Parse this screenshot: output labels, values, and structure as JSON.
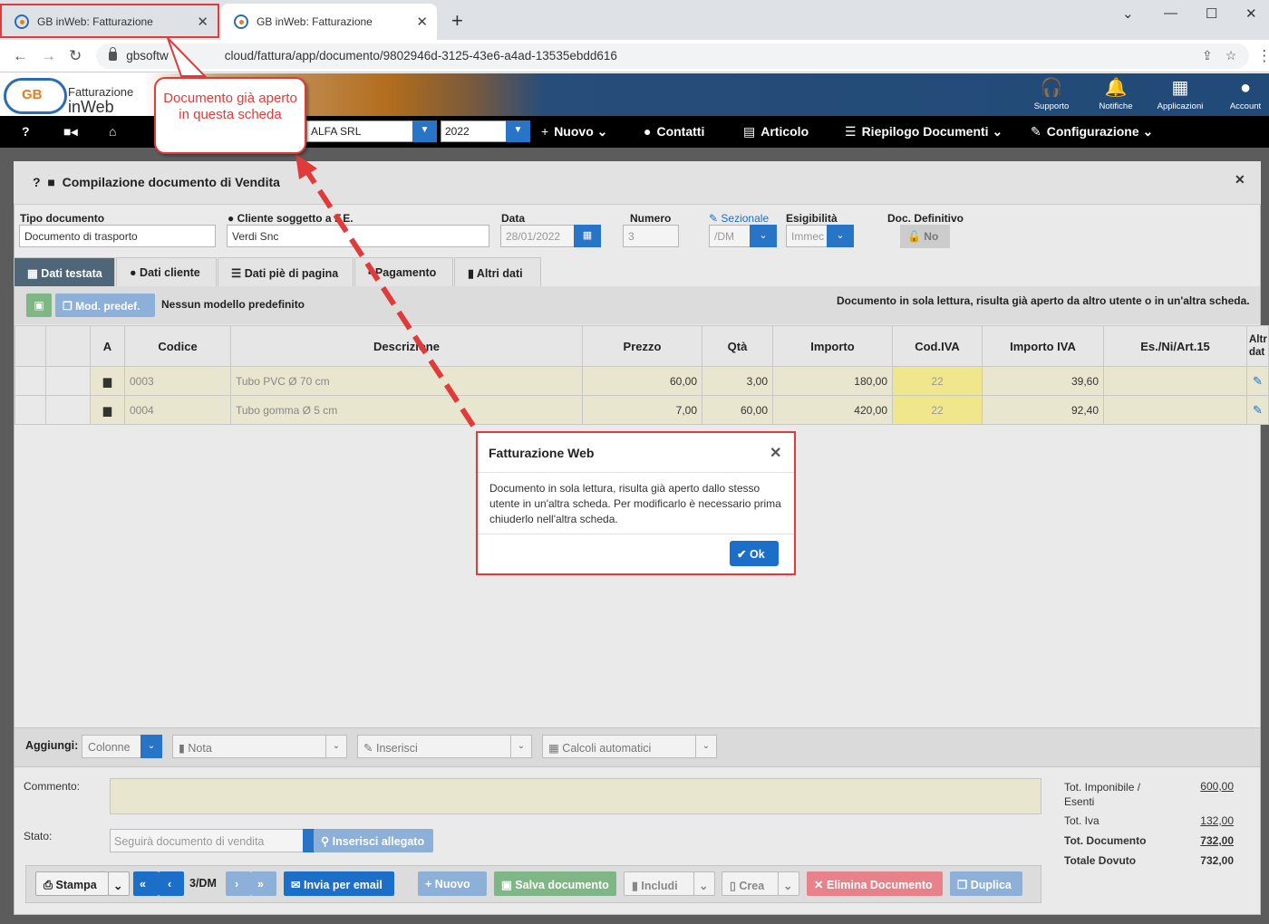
{
  "browser": {
    "tabs": [
      {
        "title": "GB inWeb: Fatturazione"
      },
      {
        "title": "GB inWeb: Fatturazione"
      }
    ],
    "url": "gbsoftware.cloud/fattura/app/documento/9802946d-3125-43e6-a4ad-13535ebdd616",
    "url_visible_prefix": "gbsoftw",
    "url_visible_suffix": "cloud/fattura/app/documento/9802946d-3125-43e6-a4ad-13535ebdd616"
  },
  "logo": {
    "line1": "Fatturazione",
    "line2": "inWeb",
    "mark": "GB"
  },
  "header_buttons": [
    {
      "label": "Supporto",
      "icon": "headset-icon"
    },
    {
      "label": "Notifiche",
      "icon": "bell-icon"
    },
    {
      "label": "Applicazioni",
      "icon": "grid-icon"
    },
    {
      "label": "Account",
      "icon": "user-icon"
    }
  ],
  "menubar": {
    "help": "?",
    "company": "ALFA SRL",
    "year": "2022",
    "items": [
      "Nuovo",
      "Contatti",
      "Articolo",
      "Riepilogo Documenti",
      "Configurazione"
    ]
  },
  "panel": {
    "title": "Compilazione documento di Vendita",
    "help": "?"
  },
  "form": {
    "tipo_label": "Tipo documento",
    "tipo_value": "Documento di trasporto",
    "cliente_label": "Cliente soggetto a F.E.",
    "cliente_value": "Verdi Snc",
    "data_label": "Data",
    "data_value": "28/01/2022",
    "numero_label": "Numero",
    "numero_value": "3",
    "sezionale_label": "Sezionale",
    "sezionale_value": "/DM",
    "esigibilita_label": "Esigibilità",
    "esigibilita_value": "Immec",
    "docdef_label": "Doc. Definitivo",
    "docdef_value": "No"
  },
  "tabs": [
    "Dati testata",
    "Dati cliente",
    "Dati piè di pagina",
    "Pagamento",
    "Altri dati"
  ],
  "toolbar": {
    "mod_label": "Mod. predef.",
    "no_model": "Nessun modello predefinito",
    "readonly_warning": "Documento in sola lettura, risulta già aperto da altro utente o in un'altra scheda."
  },
  "grid": {
    "headers": [
      "A",
      "Codice",
      "Descrizione",
      "Prezzo",
      "Qtà",
      "Importo",
      "Cod.IVA",
      "Importo IVA",
      "Es./Ni/Art.15",
      "Altr dat"
    ],
    "rows": [
      {
        "codice": "0003",
        "descrizione": "Tubo PVC Ø 70 cm",
        "prezzo": "60,00",
        "qta": "3,00",
        "importo": "180,00",
        "codiva": "22",
        "importo_iva": "39,60"
      },
      {
        "codice": "0004",
        "descrizione": "Tubo gomma Ø 5 cm",
        "prezzo": "7,00",
        "qta": "60,00",
        "importo": "420,00",
        "codiva": "22",
        "importo_iva": "92,40"
      }
    ]
  },
  "aggiungi": {
    "label": "Aggiungi:",
    "colonne": "Colonne",
    "nota": "Nota",
    "inserisci": "Inserisci",
    "calcoli": "Calcoli automatici"
  },
  "footer": {
    "commento_label": "Commento:",
    "stato_label": "Stato:",
    "stato_value": "Seguirà documento di vendita",
    "allegato": "Inserisci allegato"
  },
  "totals": [
    {
      "label": "Tot. Imponibile / Esenti",
      "value": "600,00"
    },
    {
      "label": "Tot. Iva",
      "value": "132,00"
    },
    {
      "label": "Tot. Documento",
      "value": "732,00"
    },
    {
      "label": "Totale Dovuto",
      "value": "732,00"
    }
  ],
  "buttons": {
    "stampa": "Stampa",
    "nav": "3/DM",
    "email": "Invia per email",
    "nuovo": "Nuovo",
    "salva": "Salva documento",
    "includi": "Includi",
    "crea": "Crea",
    "elimina": "Elimina Documento",
    "duplica": "Duplica"
  },
  "dialog": {
    "title": "Fatturazione Web",
    "body": "Documento in sola lettura, risulta già aperto dallo stesso utente in un'altra scheda. Per modificarlo è necessario prima chiuderlo nell'altra scheda.",
    "ok": "Ok"
  },
  "callout": {
    "text": "Documento già aperto in questa scheda",
    "color": "#e03b3b"
  }
}
